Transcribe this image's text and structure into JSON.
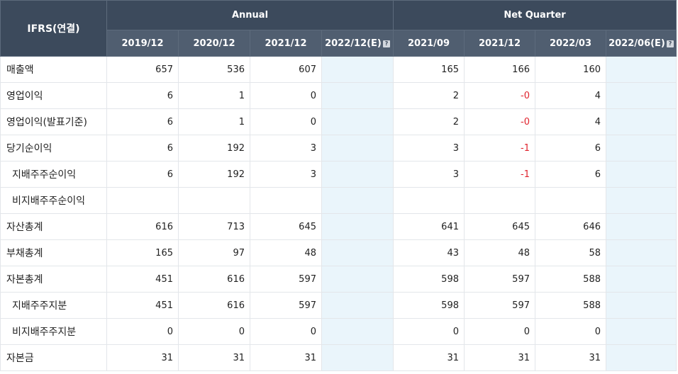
{
  "header": {
    "corner": "IFRS(연결)",
    "group_annual": "Annual",
    "group_quarter": "Net Quarter",
    "periods": [
      "2019/12",
      "2020/12",
      "2021/12",
      "2022/12(E)",
      "2021/09",
      "2021/12",
      "2022/03",
      "2022/06(E)"
    ],
    "help_glyph": "?"
  },
  "rows": [
    {
      "label": "매출액",
      "values": [
        "657",
        "536",
        "607",
        "",
        "165",
        "166",
        "160",
        ""
      ]
    },
    {
      "label": "영업이익",
      "values": [
        "6",
        "1",
        "0",
        "",
        "2",
        "-0",
        "4",
        ""
      ]
    },
    {
      "label": "영업이익(발표기준)",
      "values": [
        "6",
        "1",
        "0",
        "",
        "2",
        "-0",
        "4",
        ""
      ]
    },
    {
      "label": "당기순이익",
      "values": [
        "6",
        "192",
        "3",
        "",
        "3",
        "-1",
        "6",
        ""
      ]
    },
    {
      "label": "지배주주순이익",
      "values": [
        "6",
        "192",
        "3",
        "",
        "3",
        "-1",
        "6",
        ""
      ]
    },
    {
      "label": "비지배주주순이익",
      "values": [
        "",
        "",
        "",
        "",
        "",
        "",
        "",
        ""
      ]
    },
    {
      "label": "자산총계",
      "values": [
        "616",
        "713",
        "645",
        "",
        "641",
        "645",
        "646",
        ""
      ]
    },
    {
      "label": "부채총계",
      "values": [
        "165",
        "97",
        "48",
        "",
        "43",
        "48",
        "58",
        ""
      ]
    },
    {
      "label": "자본총계",
      "values": [
        "451",
        "616",
        "597",
        "",
        "598",
        "597",
        "588",
        ""
      ]
    },
    {
      "label": "지배주주지분",
      "values": [
        "451",
        "616",
        "597",
        "",
        "598",
        "597",
        "588",
        ""
      ]
    },
    {
      "label": "비지배주주지분",
      "values": [
        "0",
        "0",
        "0",
        "",
        "0",
        "0",
        "0",
        ""
      ]
    },
    {
      "label": "자본금",
      "values": [
        "31",
        "31",
        "31",
        "",
        "31",
        "31",
        "31",
        ""
      ]
    }
  ],
  "colors": {
    "header_bg": "#3c4a5c",
    "subheader_bg": "#505e70",
    "estimate_bg": "#eaf5fb",
    "negative": "#e0242e"
  }
}
